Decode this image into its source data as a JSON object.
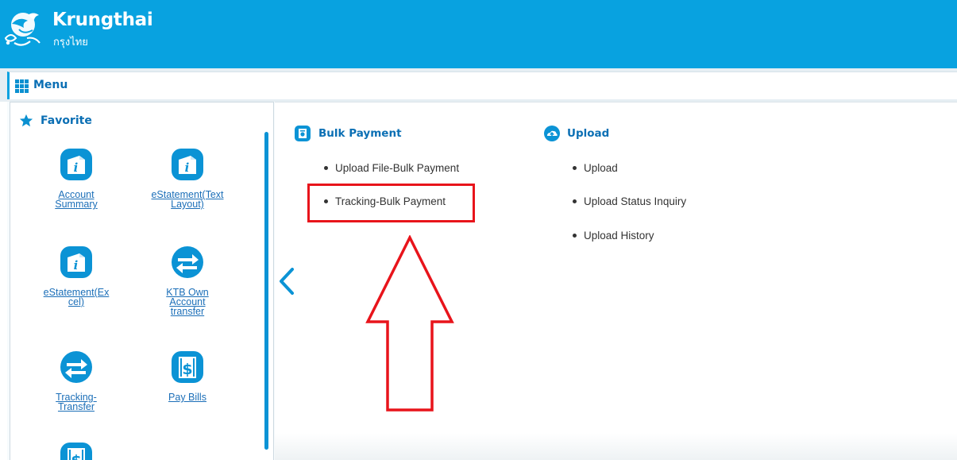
{
  "header": {
    "brand_name": "Krungthai",
    "brand_sub": "กรุงไทย",
    "logo_icon": "krungthai-bird-logo",
    "background_color": "#08a2e0"
  },
  "menubar": {
    "icon": "grid-icon",
    "label": "Menu"
  },
  "favorite": {
    "icon": "star-icon",
    "title": "Favorite",
    "tiles": [
      {
        "label": "Account Summary",
        "icon": "info-doc-icon"
      },
      {
        "label": "eStatement(Text Layout)",
        "icon": "info-doc-icon"
      },
      {
        "label": "eStatement(Excel)",
        "icon": "info-doc-icon"
      },
      {
        "label": "KTB Own Account transfer",
        "icon": "transfer-arrows-icon"
      },
      {
        "label": "Tracking-Transfer",
        "icon": "transfer-arrows-icon"
      },
      {
        "label": "Pay Bills",
        "icon": "dollar-bill-icon"
      },
      {
        "label": "",
        "icon": "dollar-bill-icon"
      }
    ]
  },
  "main": {
    "collapse_icon": "chevron-left-icon",
    "sections": [
      {
        "title": "Bulk Payment",
        "icon": "bulk-payment-icon",
        "items": [
          "Upload File-Bulk Payment",
          "Tracking-Bulk Payment"
        ]
      },
      {
        "title": "Upload",
        "icon": "upload-cloud-icon",
        "items": [
          "Upload",
          "Upload Status Inquiry",
          "Upload History"
        ]
      }
    ]
  },
  "annotation": {
    "highlight_color": "#e8141b",
    "highlighted_item": "Tracking-Bulk Payment",
    "arrow_icon": "up-arrow-outline"
  },
  "colors": {
    "accent": "#0b93d5",
    "link": "#1c6fb8",
    "section_title": "#0b6fb4"
  }
}
